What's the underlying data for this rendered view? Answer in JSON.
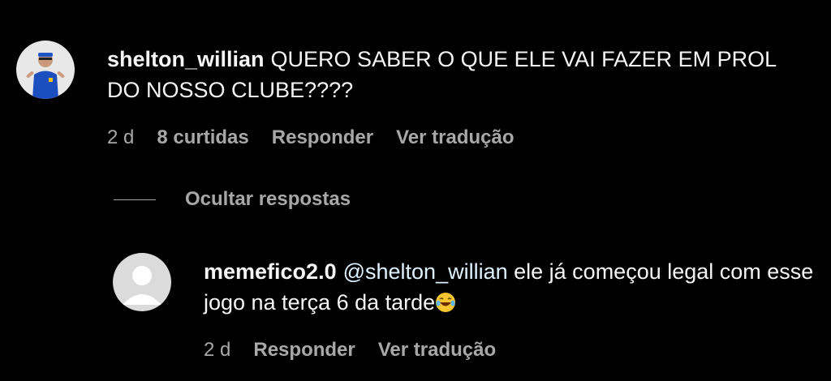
{
  "comment": {
    "username": "shelton_willian",
    "text": "QUERO SABER O QUE ELE VAI FAZER EM PROL DO NOSSO CLUBE????",
    "time": "2 d",
    "likes": "8 curtidas",
    "reply_label": "Responder",
    "translate_label": "Ver tradução"
  },
  "replies_toggle": {
    "label": "Ocultar respostas"
  },
  "reply": {
    "username": "memefico2.0",
    "mention": "@shelton_willian",
    "text": "ele já começou legal com esse jogo na terça 6 da tarde",
    "time": "2 d",
    "reply_label": "Responder",
    "translate_label": "Ver tradução"
  },
  "colors": {
    "background": "#000000",
    "text": "#f5f5f5",
    "meta": "#a8a8a8",
    "mention": "#e0f1ff"
  }
}
